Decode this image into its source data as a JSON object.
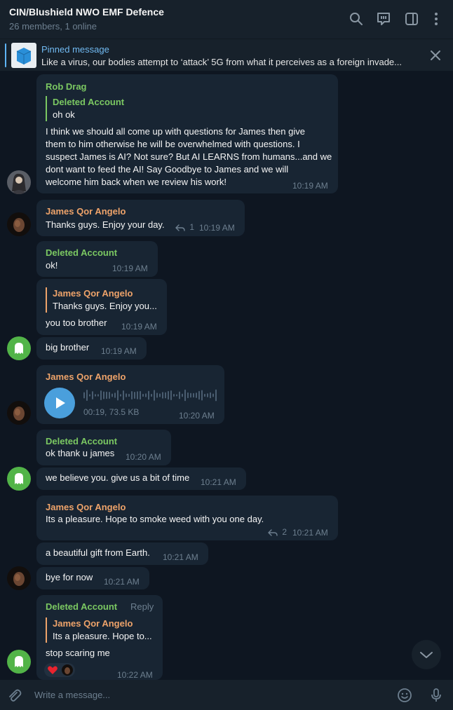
{
  "header": {
    "title": "CIN/Blushield NWO EMF Defence",
    "subtitle": "26 members, 1 online",
    "icons": [
      "search-icon",
      "discussion-icon",
      "sidebar-icon",
      "more-icon"
    ]
  },
  "pinned": {
    "title": "Pinned message",
    "text": "Like a virus, our bodies attempt to ‘attack’ 5G from what it perceives as a foreign invade..."
  },
  "messages": {
    "m1": {
      "sender": "Rob Drag",
      "quote_name": "Deleted Account",
      "quote_text": "oh ok",
      "lines": [
        "I think we should all come up with questions for James then give",
        "them to him otherwise he will be overwhelmed with questions. I",
        "suspect James is AI? Not sure? But AI LEARNS from humans...and we",
        "dont want to feed the AI! Say Goodbye to James and we will",
        "welcome him back when we review his work!"
      ],
      "time": "10:19 AM"
    },
    "m2": {
      "sender": "James Qor Angelo",
      "text": "Thanks guys. Enjoy your day.",
      "replies": "1",
      "time": "10:19 AM"
    },
    "m3": {
      "sender": "Deleted Account",
      "text": "ok!",
      "time": "10:19 AM"
    },
    "m4": {
      "quote_name": "James Qor Angelo",
      "quote_text": "Thanks guys. Enjoy you...",
      "text": "you too brother",
      "time": "10:19 AM"
    },
    "m5": {
      "text": "big brother",
      "time": "10:19 AM"
    },
    "m6": {
      "sender": "James Qor Angelo",
      "duration": "00:19, 73.5 KB",
      "time": "10:20 AM"
    },
    "m7": {
      "sender": "Deleted Account",
      "text": "ok thank u james",
      "time": "10:20 AM"
    },
    "m8": {
      "text": "we believe you. give us a bit of time",
      "time": "10:21 AM"
    },
    "m9": {
      "sender": "James Qor Angelo",
      "text": "Its a pleasure. Hope to smoke weed with you one day.",
      "replies": "2",
      "time": "10:21 AM"
    },
    "m10": {
      "text": "a beautiful gift from Earth.",
      "time": "10:21 AM"
    },
    "m11": {
      "text": "bye for now",
      "time": "10:21 AM"
    },
    "m12": {
      "sender": "Deleted Account",
      "reply_label": "Reply",
      "quote_name": "James Qor Angelo",
      "quote_text": "Its a pleasure. Hope to...",
      "text": "stop scaring me",
      "reaction": "heart",
      "time": "10:22 AM"
    }
  },
  "composer": {
    "placeholder": "Write a message..."
  },
  "colors": {
    "background": "#0e1621",
    "bubble": "#182533",
    "panel": "#17212b",
    "green_name": "#7bc862",
    "orange_name": "#eea36a",
    "accent": "#5eb5f7"
  }
}
